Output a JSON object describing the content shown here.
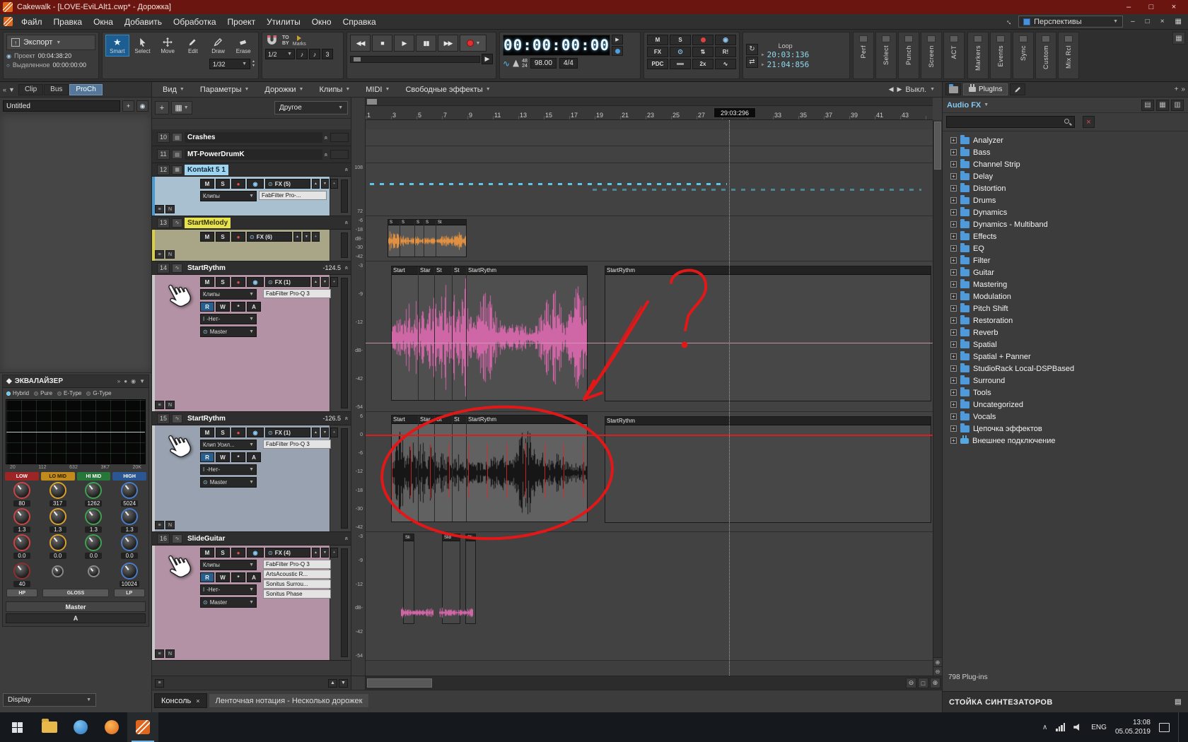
{
  "icons": {
    "dropdown": "▼",
    "up": "▲",
    "down": "▼",
    "left": "◀",
    "right": "▶",
    "double_left": "«",
    "double_right": "»",
    "plus": "+",
    "close": "×",
    "star": "★",
    "record": "●",
    "stop": "■",
    "play": "▶",
    "pause": "▮▮",
    "rewind": "◀◀",
    "forward": "▶▶",
    "note": "♪",
    "triplet": "3",
    "menu": "≡",
    "monitor": "◉",
    "minimize": "–",
    "maximize": "□",
    "power": "⊙",
    "arrows": "⇅",
    "wave": "∿",
    "radio_on": "◉",
    "radio_off": "○",
    "loop": "↻",
    "swap": "⇄",
    "n_box": "N",
    "grid": "▦",
    "rows": "▤",
    "cols": "▥",
    "zoom_in": "⊕",
    "zoom_out": "⊖",
    "box": "□",
    "up_arrow": "↑"
  },
  "window": {
    "title": "Cakewalk - [LOVE-EviLAlt1.cwp* - Дорожка]"
  },
  "menu": {
    "items": [
      "Файл",
      "Правка",
      "Окна",
      "Добавить",
      "Обработка",
      "Проект",
      "Утилиты",
      "Окно",
      "Справка"
    ],
    "perspectives": "Перспективы"
  },
  "toolbar": {
    "export_label": "Экспорт",
    "project_label": "Проект",
    "project_time": "00:04:38:20",
    "selection_label": "Выделенное",
    "selection_time": "00:00:00:00",
    "tools": [
      "Smart",
      "Select",
      "Move",
      "Edit",
      "Draw",
      "Erase"
    ],
    "draw_resolution": "1/32",
    "snap_to": "TO",
    "snap_by": "BY",
    "snap_marks": "Marks",
    "snap_value": "1/2",
    "main_time": "00:00:00:00",
    "sample_rate": "48",
    "bit_depth": "24",
    "tempo": "98.00",
    "time_signature": "4/4",
    "mute": "M",
    "solo": "S",
    "fx": "FX",
    "r_exclusive": "R!",
    "pdc": "PDC",
    "two_x": "2x",
    "loop_label": "Loop",
    "loop_start": "20:03:136",
    "loop_end": "21:04:856",
    "modules_a": [
      "Perf",
      "Select",
      "Punch",
      "Screen",
      "ACT"
    ],
    "modules_b": [
      "Markers",
      "Events",
      "Sync",
      "Custom",
      "Mix Rcl"
    ]
  },
  "inspector": {
    "tabs": [
      "Clip",
      "Bus",
      "ProCh"
    ],
    "name_value": "Untitled",
    "eq": {
      "title": "ЭКВАЛАЙЗЕР",
      "modes": [
        "Hybrid",
        "Pure",
        "E-Type",
        "G-Type"
      ],
      "freq_scale": [
        "20",
        "112",
        "632",
        "3K7",
        "20K"
      ],
      "bands": [
        {
          "label": "LOW",
          "freq": "80",
          "q": "1.3",
          "gain": "0.0"
        },
        {
          "label": "LO MID",
          "freq": "317",
          "q": "1.3",
          "gain": "0.0"
        },
        {
          "label": "HI MID",
          "freq": "1262",
          "q": "1.3",
          "gain": "0.0"
        },
        {
          "label": "HIGH",
          "freq": "5024",
          "q": "1.3",
          "gain": "0.0"
        }
      ],
      "hp_freq": "40",
      "lp_freq": "10024",
      "hp": "HP",
      "gloss": "GLOSS",
      "lp": "LP"
    },
    "output_label": "Master",
    "bus_label": "A",
    "display_label": "Display"
  },
  "track_view": {
    "menus": [
      "Вид",
      "Параметры",
      "Дорожки",
      "Клипы",
      "MIDI",
      "Свободные эффекты"
    ],
    "echo_off": "Выкл.",
    "filter": "Другое",
    "automation": {
      "read": "R",
      "write": "W",
      "offset": "*",
      "arm": "A"
    },
    "tracks": [
      {
        "num": "10",
        "name": "Crashes"
      },
      {
        "num": "11",
        "name": "MT-PowerDrumK"
      },
      {
        "num": "12",
        "name": "Kontakt 5 1",
        "fx_label": "FX (5)",
        "clips_label": "Клипы",
        "fx": [
          "FabFilter Pro-..."
        ],
        "scale": [
          "108",
          "72"
        ]
      },
      {
        "num": "13",
        "name": "StartMelody",
        "fx_label": "FX (6)",
        "scale": [
          "-6",
          "-18",
          "dB-",
          "-30",
          "-42"
        ]
      },
      {
        "num": "14",
        "name": "StartRythm",
        "value": "-124.5",
        "fx_label": "FX (1)",
        "clips_label": "Клипы",
        "fx": [
          "FabFilter Pro-Q 3"
        ],
        "input": "-Нет-",
        "output": "Master",
        "scale": [
          "-3",
          "-9",
          "-12",
          "dB-",
          "-42",
          "-54"
        ]
      },
      {
        "num": "15",
        "name": "StartRythm",
        "value": "-126.5",
        "fx_label": "FX (1)",
        "clips_label": "Клип Усил...",
        "fx": [
          "FabFilter Pro-Q 3"
        ],
        "input": "-Нет-",
        "output": "Master",
        "scale": [
          "6",
          "0",
          "-6",
          "-12",
          "-18",
          "-30",
          "-42"
        ]
      },
      {
        "num": "16",
        "name": "SlideGuitar",
        "fx_label": "FX (4)",
        "clips_label": "Клипы",
        "fx": [
          "FabFilter Pro-Q 3",
          "ArtsAcoustic R...",
          "Sonitus Surrou...",
          "Sonitus Phase"
        ],
        "input": "-Нет-",
        "output": "Master",
        "scale": [
          "-3",
          "-9",
          "-12",
          "dB-",
          "-42",
          "-54"
        ]
      }
    ]
  },
  "arrangement": {
    "ruler_ticks": [
      "1",
      "3",
      "5",
      "7",
      "9",
      "11",
      "13",
      "15",
      "17",
      "19",
      "21",
      "23",
      "25",
      "27",
      "29",
      "31",
      "33",
      "35",
      "37",
      "39",
      "41",
      "43"
    ],
    "now_time": "29:03:296",
    "lane13_clips": [
      "S",
      "S",
      "S",
      "S",
      "St"
    ],
    "lane14_clips": [
      "Start",
      "Star",
      "St",
      "St",
      "StartRythm"
    ],
    "lane14_right": "StartRythm",
    "lane15_clips": [
      "Start",
      "Star",
      "St",
      "St",
      "StartRythm"
    ],
    "lane15_right": "StartRythm",
    "lane16_clips": [
      "Sli",
      "Slid",
      "Sli"
    ]
  },
  "plugin_browser": {
    "tab": "PlugIns",
    "mode": "Audio FX",
    "search_value": "",
    "categories": [
      "Analyzer",
      "Bass",
      "Channel Strip",
      "Delay",
      "Distortion",
      "Drums",
      "Dynamics",
      "Dynamics - Multiband",
      "Effects",
      "EQ",
      "Filter",
      "Guitar",
      "Mastering",
      "Modulation",
      "Pitch Shift",
      "Restoration",
      "Reverb",
      "Spatial",
      "Spatial + Panner",
      "StudioRack Local-DSPBased",
      "Surround",
      "Tools",
      "Uncategorized",
      "Vocals",
      "Цепочка эффектов"
    ],
    "external": "Внешнее подключение",
    "count": "798 Plug-ins",
    "rack_title": "СТОЙКА СИНТЕЗАТОРОВ"
  },
  "bottom_tabs": {
    "console": "Консоль",
    "notation": "Ленточная нотация - Несколько дорожек"
  },
  "taskbar": {
    "time": "13:08",
    "date": "05.05.2019",
    "language": "ENG"
  }
}
